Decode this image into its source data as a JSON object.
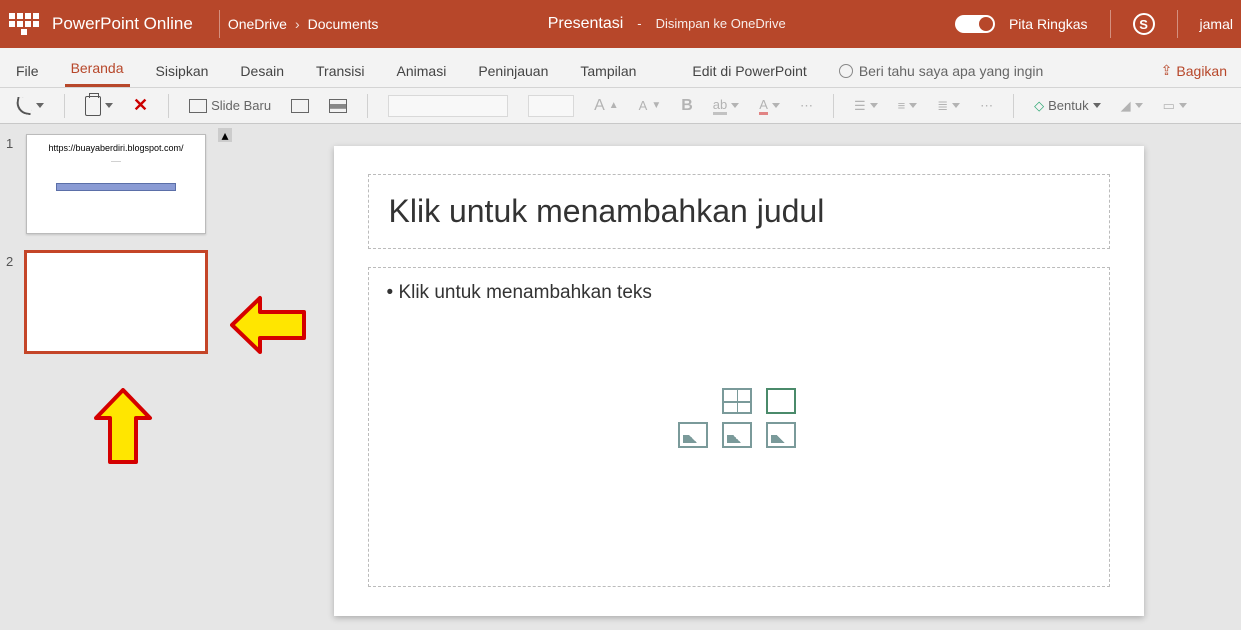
{
  "header": {
    "app_title": "PowerPoint Online",
    "breadcrumb": [
      "OneDrive",
      "Documents"
    ],
    "doc_name": "Presentasi",
    "saved_dash": "-",
    "saved_status": "Disimpan ke OneDrive",
    "ribbon_toggle_label": "Pita Ringkas",
    "skype_letter": "S",
    "user": "jamal"
  },
  "tabs": {
    "file": "File",
    "home": "Beranda",
    "insert": "Sisipkan",
    "design": "Desain",
    "transition": "Transisi",
    "animation": "Animasi",
    "review": "Peninjauan",
    "view": "Tampilan",
    "edit_in_pp": "Edit di PowerPoint",
    "tell_me": "Beri tahu saya apa yang ingin",
    "share": "Bagikan"
  },
  "toolbar": {
    "slide_baru": "Slide Baru",
    "bentuk": "Bentuk",
    "bold": "B",
    "font_size_small": "A",
    "font_size_big": "A",
    "more": "⋯",
    "underline_a": "A"
  },
  "slides_panel": {
    "slide1_num": "1",
    "slide1_url": "https://buayaberdiri.blogspot.com/",
    "slide2_num": "2"
  },
  "canvas": {
    "title_placeholder": "Klik untuk menambahkan judul",
    "body_placeholder": "Klik untuk menambahkan teks"
  }
}
